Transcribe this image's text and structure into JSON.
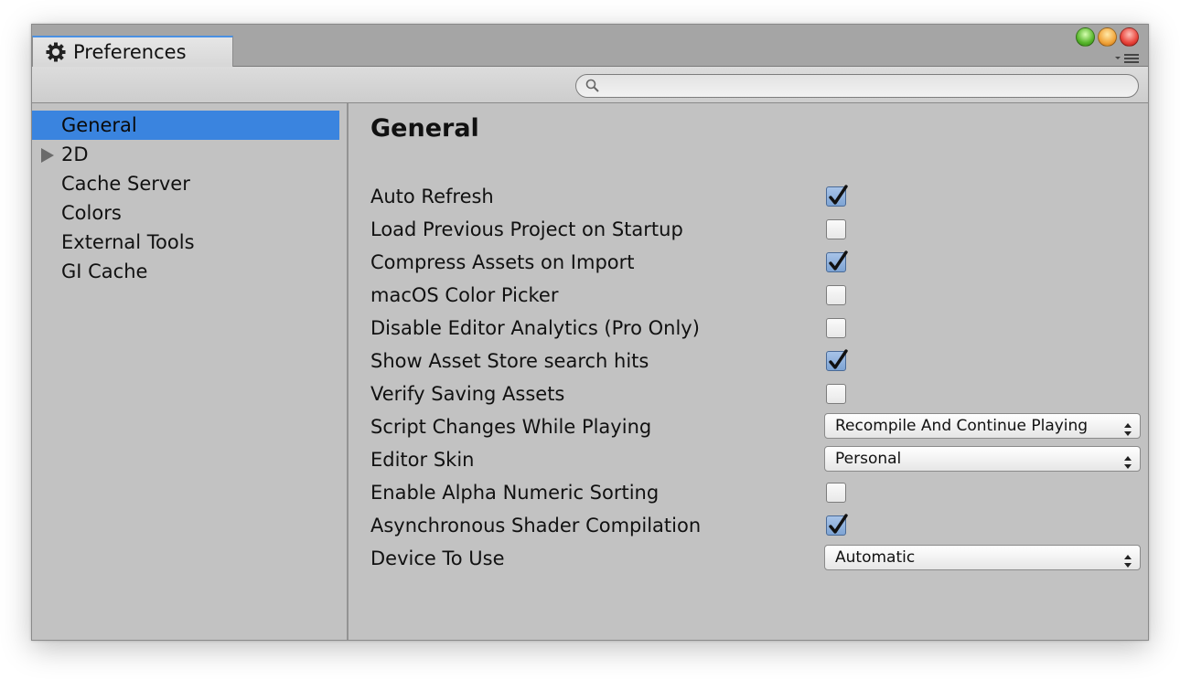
{
  "window": {
    "tab_title": "Preferences"
  },
  "search": {
    "value": "",
    "placeholder": ""
  },
  "sidebar": {
    "items": [
      {
        "label": "General"
      },
      {
        "label": "2D"
      },
      {
        "label": "Cache Server"
      },
      {
        "label": "Colors"
      },
      {
        "label": "External Tools"
      },
      {
        "label": "GI Cache"
      }
    ]
  },
  "main": {
    "heading": "General",
    "settings": [
      {
        "label": "Auto Refresh",
        "type": "checkbox",
        "checked": true
      },
      {
        "label": "Load Previous Project on Startup",
        "type": "checkbox",
        "checked": false
      },
      {
        "label": "Compress Assets on Import",
        "type": "checkbox",
        "checked": true
      },
      {
        "label": "macOS Color Picker",
        "type": "checkbox",
        "checked": false
      },
      {
        "label": "Disable Editor Analytics (Pro Only)",
        "type": "checkbox",
        "checked": false
      },
      {
        "label": "Show Asset Store search hits",
        "type": "checkbox",
        "checked": true
      },
      {
        "label": "Verify Saving Assets",
        "type": "checkbox",
        "checked": false
      },
      {
        "label": "Script Changes While Playing",
        "type": "dropdown",
        "value": "Recompile And Continue Playing"
      },
      {
        "label": "Editor Skin",
        "type": "dropdown",
        "value": "Personal"
      },
      {
        "label": "Enable Alpha Numeric Sorting",
        "type": "checkbox",
        "checked": false
      },
      {
        "label": "Asynchronous Shader Compilation",
        "type": "checkbox",
        "checked": true
      },
      {
        "label": "Device To Use",
        "type": "dropdown",
        "value": "Automatic"
      }
    ]
  },
  "colors": {
    "selection": "#3a84df",
    "panel": "#c2c2c2",
    "tab_accent": "#4a90e2"
  }
}
